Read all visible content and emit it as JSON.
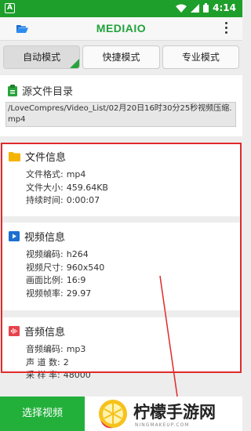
{
  "status_bar": {
    "app_badge": "A",
    "time": "4:14"
  },
  "toolbar": {
    "title": "MEDIAIO"
  },
  "tabs": [
    {
      "label": "自动模式",
      "active": true
    },
    {
      "label": "快捷模式",
      "active": false
    },
    {
      "label": "专业模式",
      "active": false
    }
  ],
  "source": {
    "heading": "源文件目录",
    "path": "/LoveCompres/Video_List/02月20日16时30分25秒视频压缩.mp4"
  },
  "file_info": {
    "heading": "文件信息",
    "rows": [
      {
        "label": "文件格式:",
        "value": "mp4"
      },
      {
        "label": "文件大小:",
        "value": "459.64KB"
      },
      {
        "label": "持续时间:",
        "value": "0:00:07"
      }
    ]
  },
  "video_info": {
    "heading": "视频信息",
    "rows": [
      {
        "label": "视频编码:",
        "value": "h264"
      },
      {
        "label": "视频尺寸:",
        "value": "960x540"
      },
      {
        "label": "画面比例:",
        "value": "16:9"
      },
      {
        "label": "视频帧率:",
        "value": "29.97"
      }
    ]
  },
  "audio_info": {
    "heading": "音频信息",
    "rows": [
      {
        "label": "音频编码:",
        "value": "mp3"
      },
      {
        "label": "声 道 数:",
        "value": "2"
      },
      {
        "label": "采 样 率:",
        "value": "48000"
      }
    ]
  },
  "bottom": {
    "select_button": "选择视频",
    "watermark_text": "柠檬手游网",
    "watermark_sub": "NINGMAKEUP.COM"
  },
  "colors": {
    "brand_green": "#22b03b",
    "highlight_red": "#e02a2a"
  }
}
